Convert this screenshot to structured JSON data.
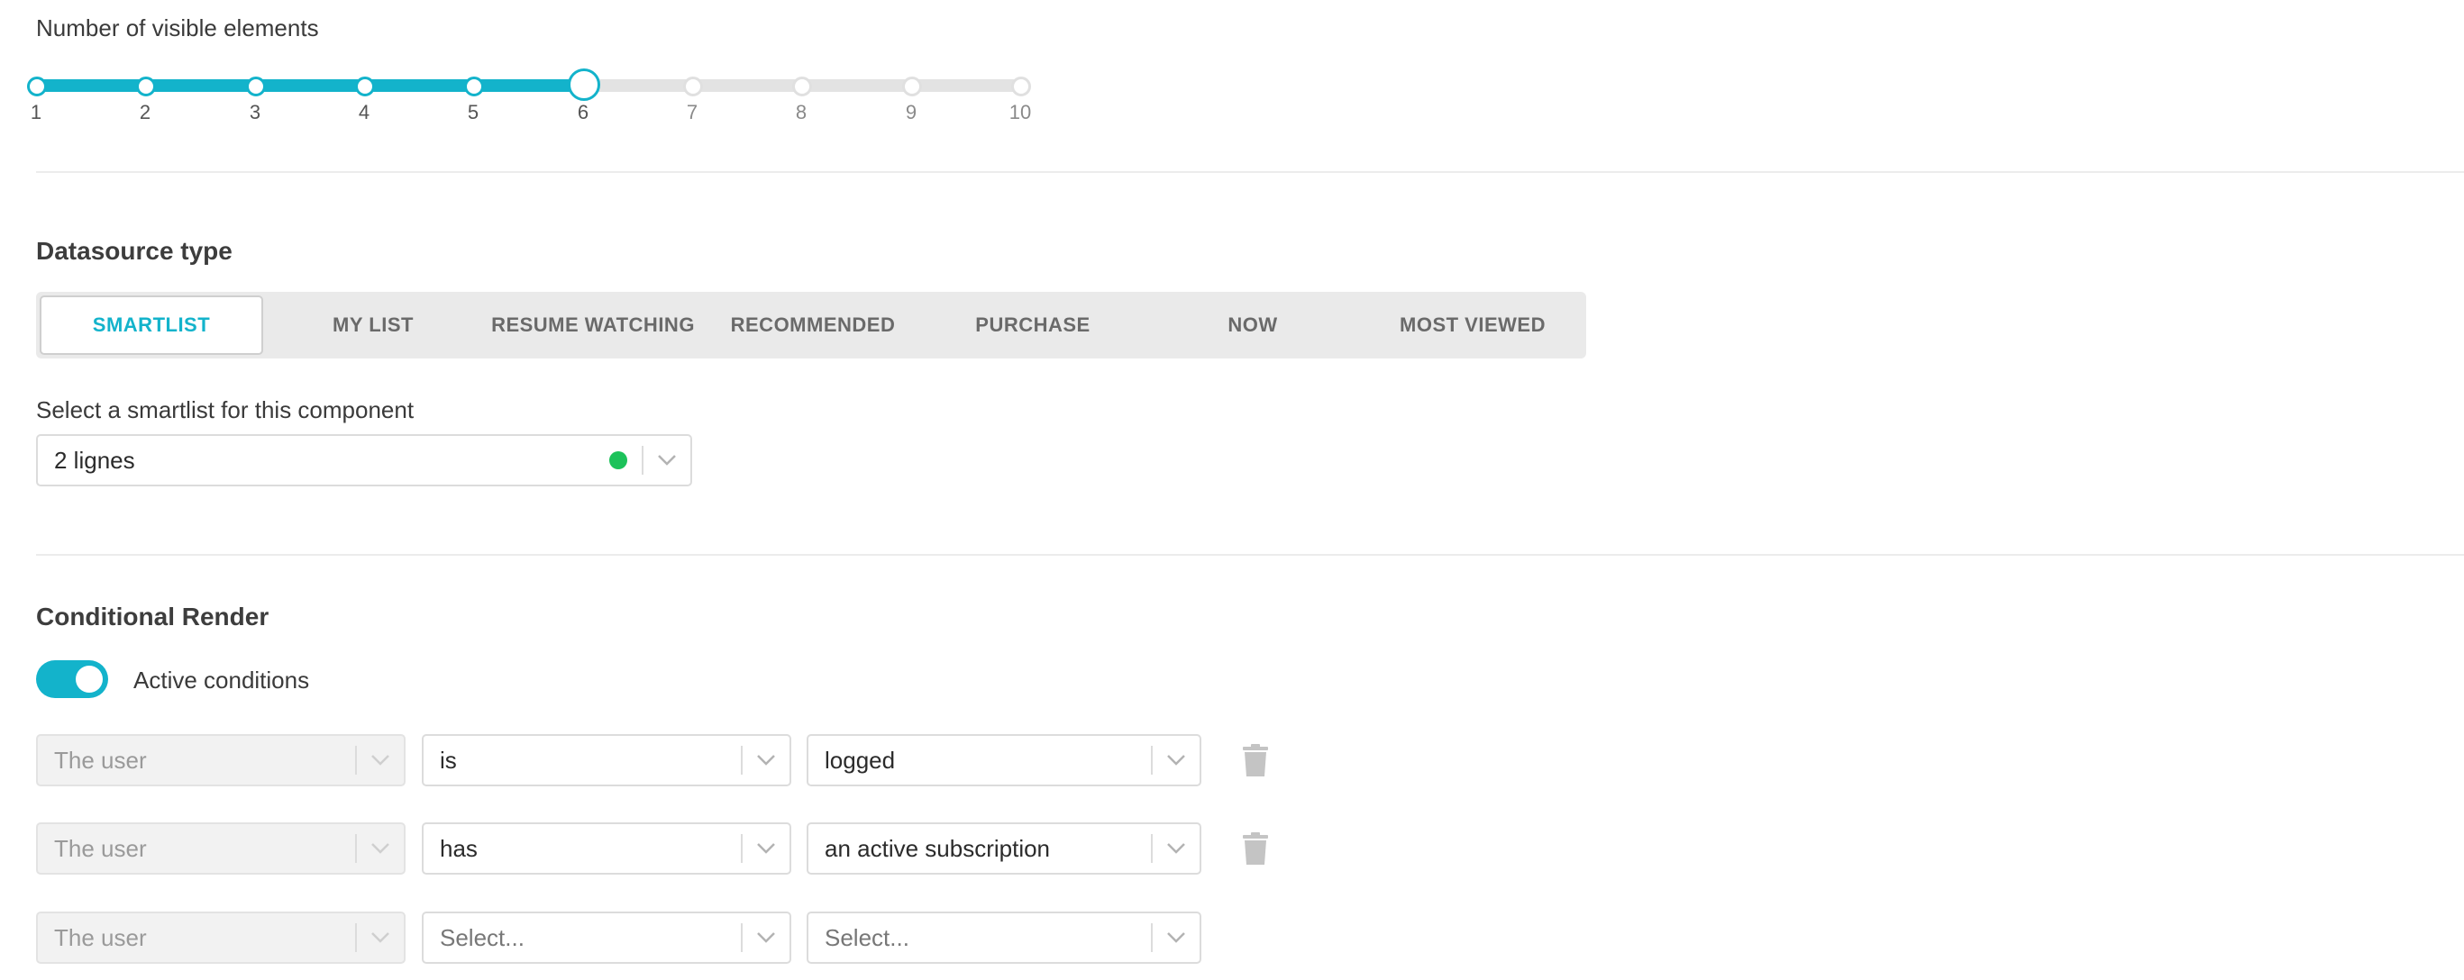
{
  "visible_elements": {
    "label": "Number of visible elements",
    "ticks": [
      "1",
      "2",
      "3",
      "4",
      "5",
      "6",
      "7",
      "8",
      "9",
      "10"
    ],
    "min": 1,
    "max": 10,
    "value": 6
  },
  "datasource": {
    "title": "Datasource type",
    "tabs": [
      "SMARTLIST",
      "MY LIST",
      "RESUME WATCHING",
      "RECOMMENDED",
      "PURCHASE",
      "NOW",
      "MOST VIEWED"
    ],
    "active_tab": "SMARTLIST",
    "smartlist_label": "Select a smartlist for this component",
    "smartlist_value": "2 lignes",
    "status_color": "#1cc25a"
  },
  "conditional": {
    "title": "Conditional Render",
    "toggle_label": "Active conditions",
    "toggle_on": true,
    "rows": [
      {
        "subject": "The user",
        "operator": "is",
        "operator_placeholder": false,
        "value": "logged",
        "value_placeholder": false,
        "deletable": true
      },
      {
        "subject": "The user",
        "operator": "has",
        "operator_placeholder": false,
        "value": "an active subscription",
        "value_placeholder": false,
        "deletable": true
      },
      {
        "subject": "The user",
        "operator": "Select...",
        "operator_placeholder": true,
        "value": "Select...",
        "value_placeholder": true,
        "deletable": false
      }
    ]
  },
  "colors": {
    "accent": "#13b3cb",
    "track": "#e3e3e3",
    "status_green": "#1cc25a"
  }
}
